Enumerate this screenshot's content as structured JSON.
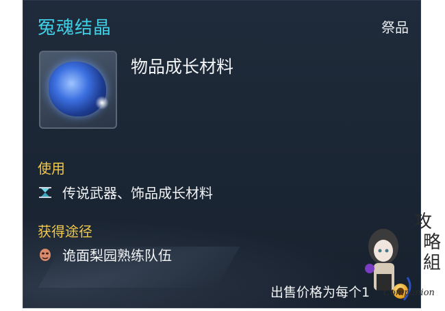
{
  "item": {
    "name": "冤魂结晶",
    "category": "祭品",
    "description": "物品成长材料",
    "icon": "blue-crystal-icon"
  },
  "usage": {
    "header": "使用",
    "text": "传说武器、饰品成长材料",
    "icon": "hourglass-icon"
  },
  "obtain": {
    "header": "获得途径",
    "text": "诡面梨园熟练队伍",
    "icon": "mask-icon"
  },
  "sell": {
    "label": "出售价格为每个1"
  },
  "watermark": {
    "logo_text": "Companion"
  },
  "colors": {
    "title": "#3fd0e6",
    "section_header": "#f2c84b",
    "panel_bg": "#1d2836",
    "text": "#f2f4f6"
  }
}
